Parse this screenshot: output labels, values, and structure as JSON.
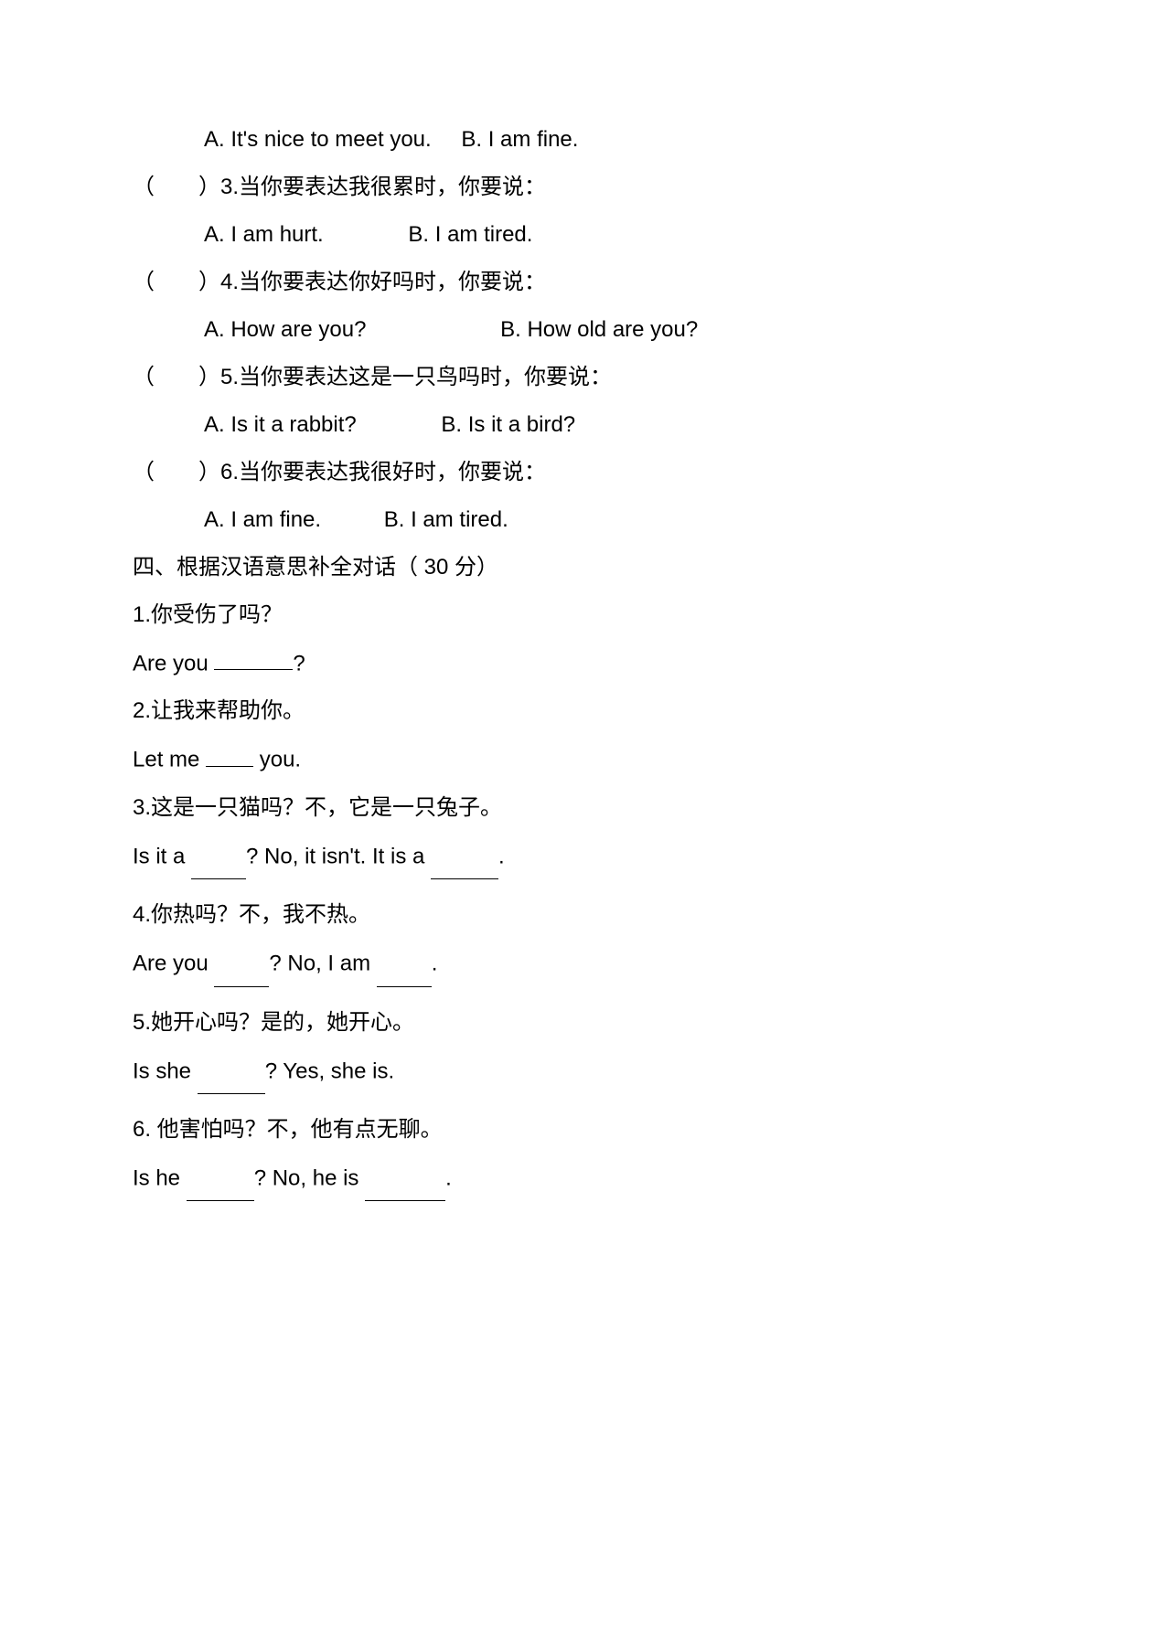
{
  "q2_opts": {
    "a": "A.  It's nice to meet you.",
    "b": "B. I am fine."
  },
  "q3": {
    "paren": "（        ）",
    "text": "3.当你要表达我很累时，你要说：",
    "a": "A.    I am hurt.",
    "b": "B. I am tired."
  },
  "q4": {
    "paren": "（        ）",
    "text": "4.当你要表达你好吗时，你要说：",
    "a": "A.    How are you?",
    "b": "B. How old are you?"
  },
  "q5": {
    "paren": "（        ）",
    "text": "5.当你要表达这是一只鸟吗时，你要说：",
    "a": "A.  Is it a rabbit?",
    "b": "B. Is it a bird?"
  },
  "q6": {
    "paren": "（        ）",
    "text": "6.当你要表达我很好时，你要说：",
    "a": "A.    I am fine.",
    "b": "B. I am tired."
  },
  "section4": "四、根据汉语意思补全对话（  30 分）",
  "f1": {
    "zh": "1.你受伤了吗？",
    "en_a": "Are you ",
    "en_b": "?"
  },
  "f2": {
    "zh": "2.让我来帮助你。",
    "en_a": "Let me ",
    "en_b": " you."
  },
  "f3": {
    "zh": "3.这是一只猫吗？不，它是一只兔子。",
    "en_a": "Is it a ",
    "en_b": "? No, it isn't. It is a ",
    "en_c": "."
  },
  "f4": {
    "zh": "4.你热吗？不，我不热。",
    "en_a": "Are you ",
    "en_b": "? No, I am ",
    "en_c": "."
  },
  "f5": {
    "zh": "5.她开心吗？是的，她开心。",
    "en_a": "Is she ",
    "en_b": "? Yes, she is."
  },
  "f6": {
    "zh": "6.  他害怕吗？不，他有点无聊。",
    "en_a": "Is he ",
    "en_b": "? No, he is ",
    "en_c": "."
  }
}
